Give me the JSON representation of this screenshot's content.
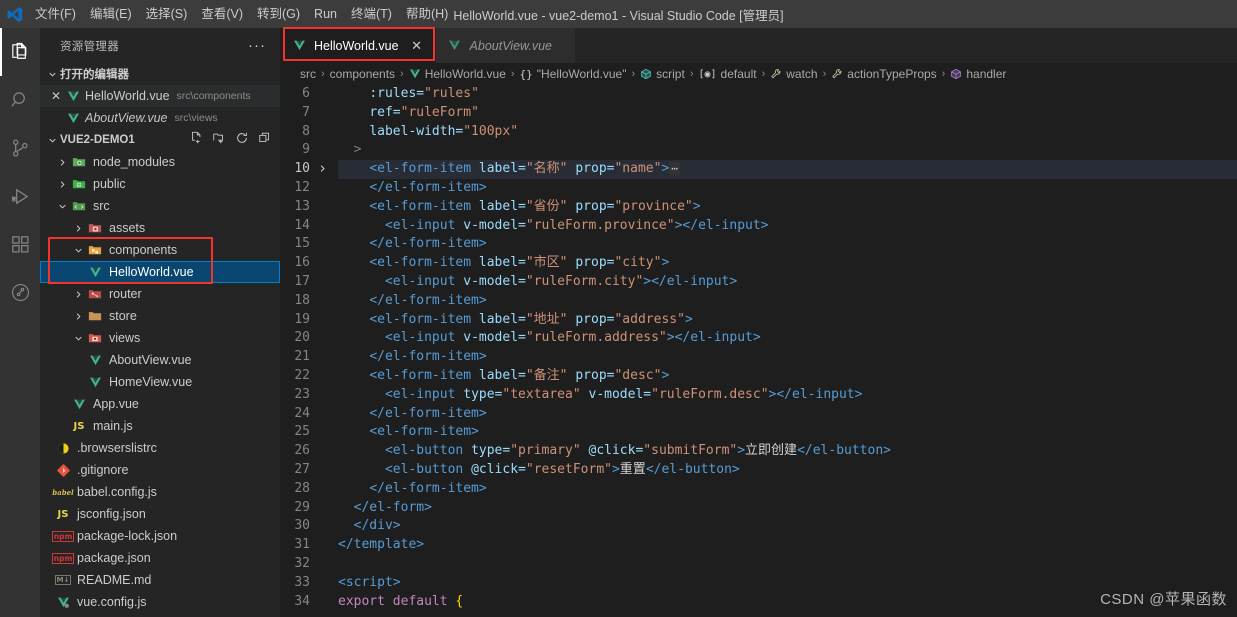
{
  "titlebar": {
    "logo_icon": "vscode-logo-icon",
    "menus": [
      {
        "label": "文件(F)",
        "name": "menu-file"
      },
      {
        "label": "编辑(E)",
        "name": "menu-edit"
      },
      {
        "label": "选择(S)",
        "name": "menu-selection"
      },
      {
        "label": "查看(V)",
        "name": "menu-view"
      },
      {
        "label": "转到(G)",
        "name": "menu-go"
      },
      {
        "label": "Run",
        "name": "menu-run"
      },
      {
        "label": "终端(T)",
        "name": "menu-terminal"
      },
      {
        "label": "帮助(H)",
        "name": "menu-help"
      }
    ],
    "window_title": "HelloWorld.vue - vue2-demo1 - Visual Studio Code [管理员]"
  },
  "activitybar": {
    "items": [
      {
        "icon": "files-explorer-icon",
        "active": true
      },
      {
        "icon": "search-icon",
        "active": false
      },
      {
        "icon": "source-control-icon",
        "active": false
      },
      {
        "icon": "run-and-debug-icon",
        "active": false
      },
      {
        "icon": "extensions-icon",
        "active": false
      },
      {
        "icon": "testing-beaker-icon",
        "active": false
      }
    ]
  },
  "sidebar": {
    "title": "资源管理器",
    "more_actions": "···",
    "open_editors": {
      "header": "打开的编辑器",
      "items": [
        {
          "name": "HelloWorld.vue",
          "desc": "src\\components",
          "icon": "vue-file-icon",
          "dirty": false,
          "italic": false,
          "closable": true
        },
        {
          "name": "AboutView.vue",
          "desc": "src\\views",
          "icon": "vue-file-icon",
          "dirty": false,
          "italic": true,
          "closable": false
        }
      ]
    },
    "project": {
      "name": "VUE2-DEMO1",
      "actions": [
        "new-file-icon",
        "new-folder-icon",
        "refresh-icon",
        "collapse-all-icon"
      ],
      "tree": [
        {
          "label": "node_modules",
          "type": "folder",
          "icon": "folder-node-modules-icon",
          "expanded": false,
          "depth": 1
        },
        {
          "label": "public",
          "type": "folder",
          "icon": "folder-public-icon",
          "expanded": false,
          "depth": 1
        },
        {
          "label": "src",
          "type": "folder",
          "icon": "folder-src-icon",
          "expanded": true,
          "depth": 1
        },
        {
          "label": "assets",
          "type": "folder",
          "icon": "folder-assets-icon",
          "expanded": false,
          "depth": 2
        },
        {
          "label": "components",
          "type": "folder",
          "icon": "folder-components-icon",
          "expanded": true,
          "depth": 2,
          "highlighted": true
        },
        {
          "label": "HelloWorld.vue",
          "type": "file",
          "icon": "vue-file-icon",
          "depth": 3,
          "selected": true
        },
        {
          "label": "router",
          "type": "folder",
          "icon": "folder-router-icon",
          "expanded": false,
          "depth": 2
        },
        {
          "label": "store",
          "type": "folder",
          "icon": "folder-store-icon",
          "expanded": false,
          "depth": 2
        },
        {
          "label": "views",
          "type": "folder",
          "icon": "folder-views-icon",
          "expanded": true,
          "depth": 2
        },
        {
          "label": "AboutView.vue",
          "type": "file",
          "icon": "vue-file-icon",
          "depth": 3
        },
        {
          "label": "HomeView.vue",
          "type": "file",
          "icon": "vue-file-icon",
          "depth": 3
        },
        {
          "label": "App.vue",
          "type": "file",
          "icon": "vue-file-icon",
          "depth": 2
        },
        {
          "label": "main.js",
          "type": "file",
          "icon": "js-file-icon",
          "depth": 2
        },
        {
          "label": ".browserslistrc",
          "type": "file",
          "icon": "browserslist-icon",
          "depth": 1
        },
        {
          "label": ".gitignore",
          "type": "file",
          "icon": "git-icon",
          "depth": 1
        },
        {
          "label": "babel.config.js",
          "type": "file",
          "icon": "babel-icon",
          "depth": 1
        },
        {
          "label": "jsconfig.json",
          "type": "file",
          "icon": "jsconfig-icon",
          "depth": 1
        },
        {
          "label": "package-lock.json",
          "type": "file",
          "icon": "npm-icon",
          "depth": 1
        },
        {
          "label": "package.json",
          "type": "file",
          "icon": "npm-icon",
          "depth": 1
        },
        {
          "label": "README.md",
          "type": "file",
          "icon": "markdown-icon",
          "depth": 1
        },
        {
          "label": "vue.config.js",
          "type": "file",
          "icon": "vue-config-icon",
          "depth": 1
        }
      ]
    }
  },
  "editor": {
    "tabs": [
      {
        "label": "HelloWorld.vue",
        "icon": "vue-file-icon",
        "active": true,
        "italic": false,
        "close_glyph": "✕"
      },
      {
        "label": "AboutView.vue",
        "icon": "vue-file-icon",
        "active": false,
        "italic": true,
        "close_glyph": ""
      }
    ],
    "breadcrumb": [
      {
        "label": "src",
        "icon": ""
      },
      {
        "label": "components",
        "icon": ""
      },
      {
        "label": "HelloWorld.vue",
        "icon": "vue-file-icon"
      },
      {
        "label": "\"HelloWorld.vue\"",
        "icon": "object-braces-icon"
      },
      {
        "label": "script",
        "icon": "module-cube-icon"
      },
      {
        "label": "default",
        "icon": "property-icon"
      },
      {
        "label": "watch",
        "icon": "wrench-icon"
      },
      {
        "label": "actionTypeProps",
        "icon": "wrench-icon"
      },
      {
        "label": "handler",
        "icon": "method-cube-icon"
      }
    ],
    "separator": "›",
    "lines": [
      {
        "num": "6",
        "fold": false,
        "current": false,
        "tokens": [
          {
            "t": "    ",
            "c": "t-txt"
          },
          {
            "t": ":rules=",
            "c": "t-attr"
          },
          {
            "t": "\"rules\"",
            "c": "t-str"
          }
        ]
      },
      {
        "num": "7",
        "fold": false,
        "current": false,
        "tokens": [
          {
            "t": "    ",
            "c": "t-txt"
          },
          {
            "t": "ref=",
            "c": "t-attr"
          },
          {
            "t": "\"ruleForm\"",
            "c": "t-str"
          }
        ]
      },
      {
        "num": "8",
        "fold": false,
        "current": false,
        "tokens": [
          {
            "t": "    ",
            "c": "t-txt"
          },
          {
            "t": "label-width=",
            "c": "t-attr"
          },
          {
            "t": "\"100px\"",
            "c": "t-str"
          }
        ]
      },
      {
        "num": "9",
        "fold": false,
        "current": false,
        "tokens": [
          {
            "t": "  ",
            "c": "t-txt"
          },
          {
            "t": ">",
            "c": "t-punct"
          }
        ]
      },
      {
        "num": "10",
        "fold": true,
        "current": true,
        "tokens": [
          {
            "t": "    ",
            "c": "t-txt"
          },
          {
            "t": "<el-form-item",
            "c": "t-tag"
          },
          {
            "t": " label=",
            "c": "t-attr"
          },
          {
            "t": "\"名称\"",
            "c": "t-str"
          },
          {
            "t": " prop=",
            "c": "t-attr"
          },
          {
            "t": "\"name\"",
            "c": "t-str"
          },
          {
            "t": ">",
            "c": "t-tag"
          },
          {
            "t": "⋯",
            "c": "t-dots"
          }
        ]
      },
      {
        "num": "12",
        "fold": false,
        "current": false,
        "tokens": [
          {
            "t": "    ",
            "c": "t-txt"
          },
          {
            "t": "</el-form-item>",
            "c": "t-tag"
          }
        ]
      },
      {
        "num": "13",
        "fold": false,
        "current": false,
        "tokens": [
          {
            "t": "    ",
            "c": "t-txt"
          },
          {
            "t": "<el-form-item",
            "c": "t-tag"
          },
          {
            "t": " label=",
            "c": "t-attr"
          },
          {
            "t": "\"省份\"",
            "c": "t-str"
          },
          {
            "t": " prop=",
            "c": "t-attr"
          },
          {
            "t": "\"province\"",
            "c": "t-str"
          },
          {
            "t": ">",
            "c": "t-tag"
          }
        ]
      },
      {
        "num": "14",
        "fold": false,
        "current": false,
        "tokens": [
          {
            "t": "      ",
            "c": "t-txt"
          },
          {
            "t": "<el-input",
            "c": "t-tag"
          },
          {
            "t": " v-model=",
            "c": "t-attr"
          },
          {
            "t": "\"ruleForm.province\"",
            "c": "t-str"
          },
          {
            "t": "></el-input>",
            "c": "t-tag"
          }
        ]
      },
      {
        "num": "15",
        "fold": false,
        "current": false,
        "tokens": [
          {
            "t": "    ",
            "c": "t-txt"
          },
          {
            "t": "</el-form-item>",
            "c": "t-tag"
          }
        ]
      },
      {
        "num": "16",
        "fold": false,
        "current": false,
        "tokens": [
          {
            "t": "    ",
            "c": "t-txt"
          },
          {
            "t": "<el-form-item",
            "c": "t-tag"
          },
          {
            "t": " label=",
            "c": "t-attr"
          },
          {
            "t": "\"市区\"",
            "c": "t-str"
          },
          {
            "t": " prop=",
            "c": "t-attr"
          },
          {
            "t": "\"city\"",
            "c": "t-str"
          },
          {
            "t": ">",
            "c": "t-tag"
          }
        ]
      },
      {
        "num": "17",
        "fold": false,
        "current": false,
        "tokens": [
          {
            "t": "      ",
            "c": "t-txt"
          },
          {
            "t": "<el-input",
            "c": "t-tag"
          },
          {
            "t": " v-model=",
            "c": "t-attr"
          },
          {
            "t": "\"ruleForm.city\"",
            "c": "t-str"
          },
          {
            "t": "></el-input>",
            "c": "t-tag"
          }
        ]
      },
      {
        "num": "18",
        "fold": false,
        "current": false,
        "tokens": [
          {
            "t": "    ",
            "c": "t-txt"
          },
          {
            "t": "</el-form-item>",
            "c": "t-tag"
          }
        ]
      },
      {
        "num": "19",
        "fold": false,
        "current": false,
        "tokens": [
          {
            "t": "    ",
            "c": "t-txt"
          },
          {
            "t": "<el-form-item",
            "c": "t-tag"
          },
          {
            "t": " label=",
            "c": "t-attr"
          },
          {
            "t": "\"地址\"",
            "c": "t-str"
          },
          {
            "t": " prop=",
            "c": "t-attr"
          },
          {
            "t": "\"address\"",
            "c": "t-str"
          },
          {
            "t": ">",
            "c": "t-tag"
          }
        ]
      },
      {
        "num": "20",
        "fold": false,
        "current": false,
        "tokens": [
          {
            "t": "      ",
            "c": "t-txt"
          },
          {
            "t": "<el-input",
            "c": "t-tag"
          },
          {
            "t": " v-model=",
            "c": "t-attr"
          },
          {
            "t": "\"ruleForm.address\"",
            "c": "t-str"
          },
          {
            "t": "></el-input>",
            "c": "t-tag"
          }
        ]
      },
      {
        "num": "21",
        "fold": false,
        "current": false,
        "tokens": [
          {
            "t": "    ",
            "c": "t-txt"
          },
          {
            "t": "</el-form-item>",
            "c": "t-tag"
          }
        ]
      },
      {
        "num": "22",
        "fold": false,
        "current": false,
        "tokens": [
          {
            "t": "    ",
            "c": "t-txt"
          },
          {
            "t": "<el-form-item",
            "c": "t-tag"
          },
          {
            "t": " label=",
            "c": "t-attr"
          },
          {
            "t": "\"备注\"",
            "c": "t-str"
          },
          {
            "t": " prop=",
            "c": "t-attr"
          },
          {
            "t": "\"desc\"",
            "c": "t-str"
          },
          {
            "t": ">",
            "c": "t-tag"
          }
        ]
      },
      {
        "num": "23",
        "fold": false,
        "current": false,
        "tokens": [
          {
            "t": "      ",
            "c": "t-txt"
          },
          {
            "t": "<el-input",
            "c": "t-tag"
          },
          {
            "t": " type=",
            "c": "t-attr"
          },
          {
            "t": "\"textarea\"",
            "c": "t-str"
          },
          {
            "t": " v-model=",
            "c": "t-attr"
          },
          {
            "t": "\"ruleForm.desc\"",
            "c": "t-str"
          },
          {
            "t": "></el-input>",
            "c": "t-tag"
          }
        ]
      },
      {
        "num": "24",
        "fold": false,
        "current": false,
        "tokens": [
          {
            "t": "    ",
            "c": "t-txt"
          },
          {
            "t": "</el-form-item>",
            "c": "t-tag"
          }
        ]
      },
      {
        "num": "25",
        "fold": false,
        "current": false,
        "tokens": [
          {
            "t": "    ",
            "c": "t-txt"
          },
          {
            "t": "<el-form-item>",
            "c": "t-tag"
          }
        ]
      },
      {
        "num": "26",
        "fold": false,
        "current": false,
        "tokens": [
          {
            "t": "      ",
            "c": "t-txt"
          },
          {
            "t": "<el-button",
            "c": "t-tag"
          },
          {
            "t": " type=",
            "c": "t-attr"
          },
          {
            "t": "\"primary\"",
            "c": "t-str"
          },
          {
            "t": " @click=",
            "c": "t-attr"
          },
          {
            "t": "\"submitForm\"",
            "c": "t-str"
          },
          {
            "t": ">",
            "c": "t-tag"
          },
          {
            "t": "立即创建",
            "c": "t-txt"
          },
          {
            "t": "</el-button>",
            "c": "t-tag"
          }
        ]
      },
      {
        "num": "27",
        "fold": false,
        "current": false,
        "tokens": [
          {
            "t": "      ",
            "c": "t-txt"
          },
          {
            "t": "<el-button",
            "c": "t-tag"
          },
          {
            "t": " @click=",
            "c": "t-attr"
          },
          {
            "t": "\"resetForm\"",
            "c": "t-str"
          },
          {
            "t": ">",
            "c": "t-tag"
          },
          {
            "t": "重置",
            "c": "t-txt"
          },
          {
            "t": "</el-button>",
            "c": "t-tag"
          }
        ]
      },
      {
        "num": "28",
        "fold": false,
        "current": false,
        "tokens": [
          {
            "t": "    ",
            "c": "t-txt"
          },
          {
            "t": "</el-form-item>",
            "c": "t-tag"
          }
        ]
      },
      {
        "num": "29",
        "fold": false,
        "current": false,
        "tokens": [
          {
            "t": "  ",
            "c": "t-txt"
          },
          {
            "t": "</el-form>",
            "c": "t-tag"
          }
        ]
      },
      {
        "num": "30",
        "fold": false,
        "current": false,
        "tokens": [
          {
            "t": "  ",
            "c": "t-txt"
          },
          {
            "t": "</div>",
            "c": "t-tag"
          }
        ]
      },
      {
        "num": "31",
        "fold": false,
        "current": false,
        "tokens": [
          {
            "t": "</template>",
            "c": "t-tag"
          }
        ]
      },
      {
        "num": "32",
        "fold": false,
        "current": false,
        "tokens": []
      },
      {
        "num": "33",
        "fold": false,
        "current": false,
        "tokens": [
          {
            "t": "<script>",
            "c": "t-tag"
          }
        ]
      },
      {
        "num": "34",
        "fold": false,
        "current": false,
        "tokens": [
          {
            "t": "export default ",
            "c": "t-kw"
          },
          {
            "t": "{",
            "c": "t-brace"
          }
        ]
      }
    ]
  },
  "watermark": "CSDN @苹果函数",
  "colors": {
    "accent_blue": "#007fd4",
    "selection_blue": "#094771",
    "annotation_red": "#f2342a",
    "editor_bg": "#1e1e1e",
    "sidebar_bg": "#252526",
    "titlebar_bg": "#3c3c3c",
    "activitybar_bg": "#333333",
    "vue_green": "#41b883"
  }
}
